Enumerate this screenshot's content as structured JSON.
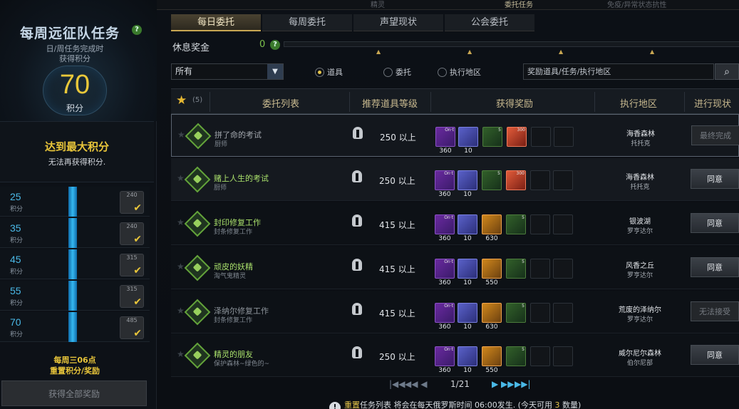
{
  "topnav": {
    "items": [
      {
        "label": "精灵",
        "active": false
      },
      {
        "label": "委托任务",
        "active": true
      },
      {
        "label": "免疫/异常状态抗性",
        "active": false
      }
    ]
  },
  "left": {
    "title": "每周远征队任务",
    "subtitle1": "日/周任务完成时",
    "subtitle2": "获得积分",
    "points": "70",
    "points_unit": "积分",
    "max_title": "达到最大积分",
    "max_sub": "无法再获得积分.",
    "tiers": [
      {
        "points": "25",
        "unit": "积分",
        "reward": "240",
        "claimed": true
      },
      {
        "points": "35",
        "unit": "积分",
        "reward": "240",
        "claimed": true
      },
      {
        "points": "45",
        "unit": "积分",
        "reward": "315",
        "claimed": true
      },
      {
        "points": "55",
        "unit": "积分",
        "reward": "315",
        "claimed": true
      },
      {
        "points": "70",
        "unit": "积分",
        "reward": "485",
        "claimed": true
      }
    ],
    "reset1": "每周三06点",
    "reset2": "重置积分/奖励",
    "claim_all": "获得全部奖励"
  },
  "tabs": [
    {
      "label": "每日委托",
      "active": true
    },
    {
      "label": "每周委托",
      "active": false
    },
    {
      "label": "声望现状",
      "active": false
    },
    {
      "label": "公会委托",
      "active": false
    }
  ],
  "bonus": {
    "label": "休息奖金",
    "value": "0"
  },
  "filter": {
    "select": "所有",
    "radios": [
      {
        "label": "道具",
        "selected": true
      },
      {
        "label": "委托",
        "selected": false
      },
      {
        "label": "执行地区",
        "selected": false
      }
    ],
    "search_placeholder": "奖励道具/任务/执行地区"
  },
  "table": {
    "fav_count": "(5)",
    "headers": [
      "委托列表",
      "推荐道具等级",
      "获得奖励",
      "执行地区",
      "进行现状"
    ],
    "rows": [
      {
        "name": "拼了命的考试",
        "sub": "厨师",
        "level": "250 以上",
        "rewards": [
          {
            "t": "g",
            "sub": "On·t",
            "c": "360"
          },
          {
            "t": "b",
            "c": "10"
          },
          {
            "t": "sc",
            "sub": "5",
            "c": ""
          },
          {
            "t": "h",
            "sub": "300",
            "c": ""
          }
        ],
        "loc1": "海香森林",
        "loc2": "托托克",
        "status": "最终完成",
        "btn": "off",
        "style": "sel",
        "color": "#a3a8ae"
      },
      {
        "name": "赌上人生的考试",
        "sub": "厨师",
        "level": "250 以上",
        "rewards": [
          {
            "t": "g",
            "sub": "On·t",
            "c": "360"
          },
          {
            "t": "b",
            "c": "10"
          },
          {
            "t": "sc",
            "sub": "5",
            "c": ""
          },
          {
            "t": "h",
            "sub": "300",
            "c": ""
          }
        ],
        "loc1": "海香森林",
        "loc2": "托托克",
        "status": "同意",
        "btn": "on",
        "style": "hl",
        "color": "#a9e06b"
      },
      {
        "name": "封印修复工作",
        "sub": "封条修复工作",
        "level": "415 以上",
        "rewards": [
          {
            "t": "g",
            "sub": "On·t",
            "c": "360"
          },
          {
            "t": "b",
            "c": "10"
          },
          {
            "t": "o",
            "c": "630"
          },
          {
            "t": "sc",
            "sub": "5",
            "c": ""
          }
        ],
        "loc1": "银波湖",
        "loc2": "罗亨达尔",
        "status": "同意",
        "btn": "on",
        "style": "",
        "color": "#a9e06b"
      },
      {
        "name": "顽皮的妖精",
        "sub": "淘气鬼精灵",
        "level": "415 以上",
        "rewards": [
          {
            "t": "g",
            "sub": "On·t",
            "c": "360"
          },
          {
            "t": "b",
            "c": "10"
          },
          {
            "t": "o",
            "c": "550"
          },
          {
            "t": "sc",
            "sub": "5",
            "c": ""
          }
        ],
        "loc1": "风香之丘",
        "loc2": "罗亨达尔",
        "status": "同意",
        "btn": "on",
        "style": "",
        "color": "#a9e06b"
      },
      {
        "name": "泽纳尔修复工作",
        "sub": "封条修复工作",
        "level": "415 以上",
        "rewards": [
          {
            "t": "g",
            "sub": "On·t",
            "c": "360"
          },
          {
            "t": "b",
            "c": "10"
          },
          {
            "t": "o",
            "c": "630"
          },
          {
            "t": "sc",
            "sub": "5",
            "c": ""
          }
        ],
        "loc1": "荒废的泽纳尔",
        "loc2": "罗亨达尔",
        "status": "无法接受",
        "btn": "off",
        "style": "",
        "color": "#8e959c"
      },
      {
        "name": "精灵的朋友",
        "sub": "保护森林~绿色的~",
        "level": "250 以上",
        "rewards": [
          {
            "t": "g",
            "sub": "On·t",
            "c": "360"
          },
          {
            "t": "b",
            "c": "10"
          },
          {
            "t": "o",
            "c": "550"
          },
          {
            "t": "sc",
            "sub": "5",
            "c": ""
          }
        ],
        "loc1": "威尔尼尔森林",
        "loc2": "伯尔尼部",
        "status": "同意",
        "btn": "on",
        "style": "",
        "color": "#a9e06b"
      }
    ]
  },
  "pager": {
    "first": "|◀◀",
    "prev": "◀◀ ◀",
    "page": "1/21",
    "next": "▶ ▶▶",
    "last": "▶▶|"
  },
  "notice": {
    "icon": "!",
    "pre": "重置",
    "text": "任务列表 将会在每天俄罗斯时间 06:00发生. (今天可用 ",
    "count": "3",
    "post": " 数量)"
  }
}
